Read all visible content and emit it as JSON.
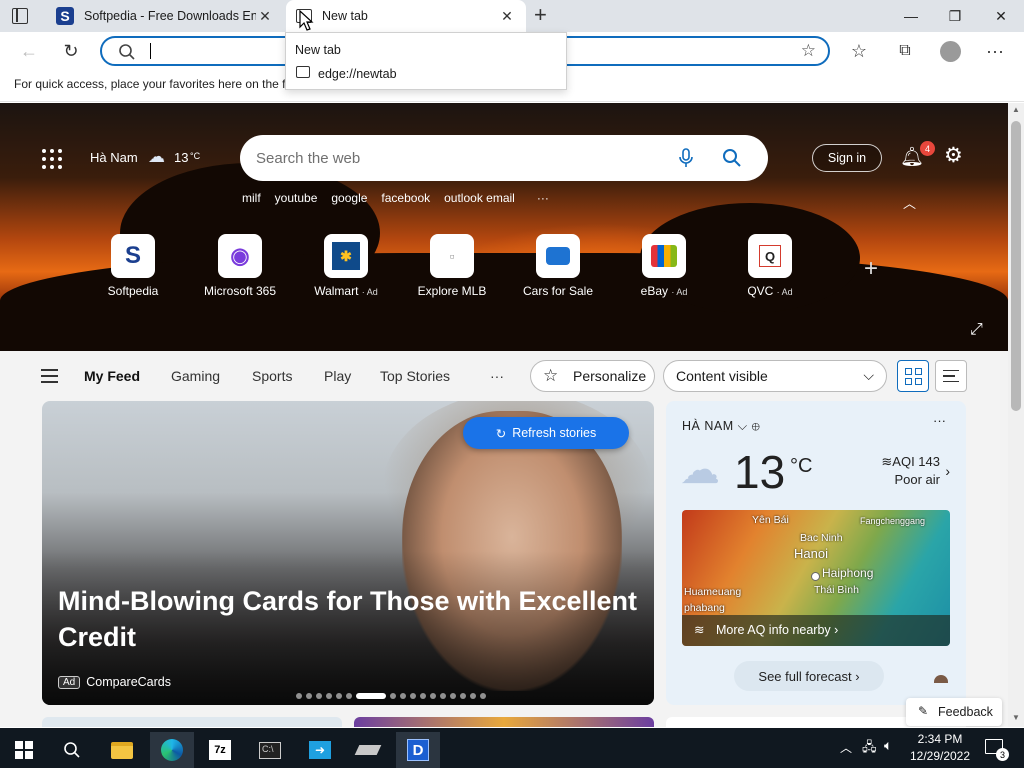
{
  "browser": {
    "tabs": [
      {
        "title": "Softpedia - Free Downloads Encyclopedia",
        "active": false
      },
      {
        "title": "New tab",
        "active": true
      }
    ],
    "address_placeholder": "",
    "favorites_hint": "For quick access, place your favorites here on the favorites bar.",
    "dropdown": {
      "title": "New tab",
      "url": "edge://newtab"
    }
  },
  "hero": {
    "location": "Hà Nam",
    "temperature": "13",
    "temp_unit": "°C",
    "search_placeholder": "Search the web",
    "trending": [
      "milf",
      "youtube",
      "google",
      "facebook",
      "outlook email"
    ],
    "signin_label": "Sign in",
    "notification_count": "4",
    "tiles": [
      {
        "label": "Softpedia",
        "ad": "",
        "glyph": "S",
        "color": "#1b3f8f"
      },
      {
        "label": "Microsoft 365",
        "ad": "",
        "glyph": "◉",
        "color": "#7a3bdc"
      },
      {
        "label": "Walmart",
        "ad": "· Ad",
        "glyph": "✱",
        "color": "#0f4a8a"
      },
      {
        "label": "Explore MLB",
        "ad": "",
        "glyph": "▫",
        "color": "#888888"
      },
      {
        "label": "Cars for Sale",
        "ad": "",
        "glyph": "🚘",
        "color": "#1e73d2"
      },
      {
        "label": "eBay",
        "ad": "· Ad",
        "glyph": "▤",
        "color": "#d43b2e"
      },
      {
        "label": "QVC",
        "ad": "· Ad",
        "glyph": "Q",
        "color": "#222222"
      }
    ]
  },
  "feed_nav": {
    "items": [
      "My Feed",
      "Gaming",
      "Sports",
      "Play",
      "Top Stories"
    ],
    "active": "My Feed",
    "more": "···",
    "personalize_label": "Personalize",
    "content_select": "Content visible"
  },
  "main_card": {
    "headline": "Mind-Blowing Cards for Those with Excellent Credit",
    "ad_tag": "Ad",
    "source": "CompareCards",
    "refresh_label": "Refresh stories",
    "carousel_count": 17,
    "carousel_active": 6
  },
  "weather": {
    "location": "HÀ NAM",
    "temperature": "13",
    "unit": "°C",
    "aqi": "AQI 143",
    "aqi_status": "Poor air",
    "map_labels": [
      "Yên Bái",
      "Bac Ninh",
      "Hanoi",
      "Haiphong",
      "Thái Bình",
      "Huameuang",
      "phabang",
      "Fangchenggang"
    ],
    "aq_link": "More AQ info nearby",
    "forecast_label": "See full forecast"
  },
  "feedback_label": "Feedback",
  "taskbar": {
    "time": "2:34 PM",
    "date": "12/29/2022",
    "notification_count": "3"
  },
  "colors": {
    "accent": "#0f6cbd",
    "refresh_button": "#1a73e8",
    "badge": "#e8473c",
    "taskbar": "#101820"
  }
}
